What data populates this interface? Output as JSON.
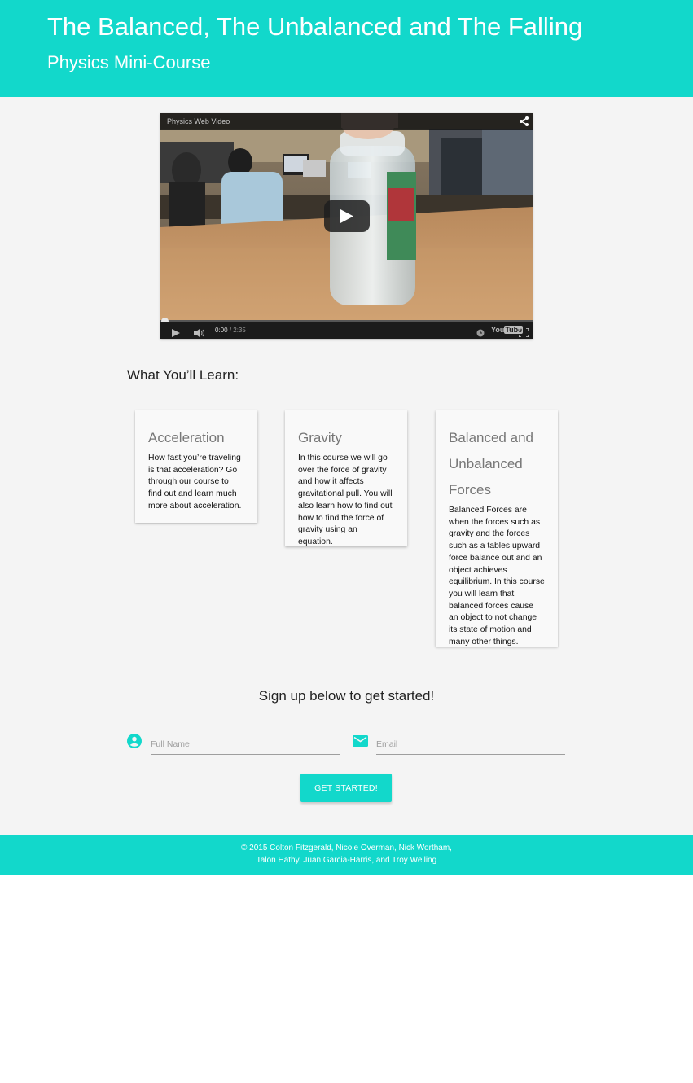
{
  "header": {
    "title": "The Balanced, The Unbalanced and The Falling",
    "subtitle": "Physics Mini-Course"
  },
  "video": {
    "title": "Physics Web Video",
    "current_time": "0:00",
    "duration": "/ 2:35",
    "brand": "YouTube",
    "progress": 0
  },
  "learn": {
    "heading": "What You’ll Learn:",
    "cards": [
      {
        "title": "Acceleration",
        "body": "How fast you’re traveling is that acceleration? Go through our course to find out and learn much more about acceleration."
      },
      {
        "title": "Gravity",
        "body": "In this course we will go over the force of gravity and how it affects gravitational pull. You will also learn how to find out how to find the force of gravity using an equation."
      },
      {
        "title": "Balanced and Unbalanced Forces",
        "body": "Balanced Forces are when the forces such as gravity and the forces such as a tables upward force balance out and an object achieves equilibrium. In this course you will learn that balanced forces cause an object to not change its state of motion and many other things."
      }
    ]
  },
  "signup": {
    "heading": "Sign up below to get started!",
    "name_placeholder": "Full Name",
    "email_placeholder": "Email",
    "button_label": "GET STARTED!"
  },
  "footer": {
    "line1": "© 2015 Colton Fitzgerald, Nicole Overman, Nick Wortham,",
    "line2": "Talon Hathy, Juan Garcia-Harris, and Troy Welling"
  },
  "colors": {
    "accent": "#12d8cb",
    "page_background": "#f4f4f4",
    "card_background": "#f9f9f9"
  },
  "icons": {
    "name_field": "account-circle-icon",
    "email_field": "email-icon",
    "video_share": "share-icon",
    "video_play": "play-icon",
    "video_volume": "volume-icon",
    "video_watch_later": "clock-icon",
    "video_fullscreen": "fullscreen-icon"
  }
}
